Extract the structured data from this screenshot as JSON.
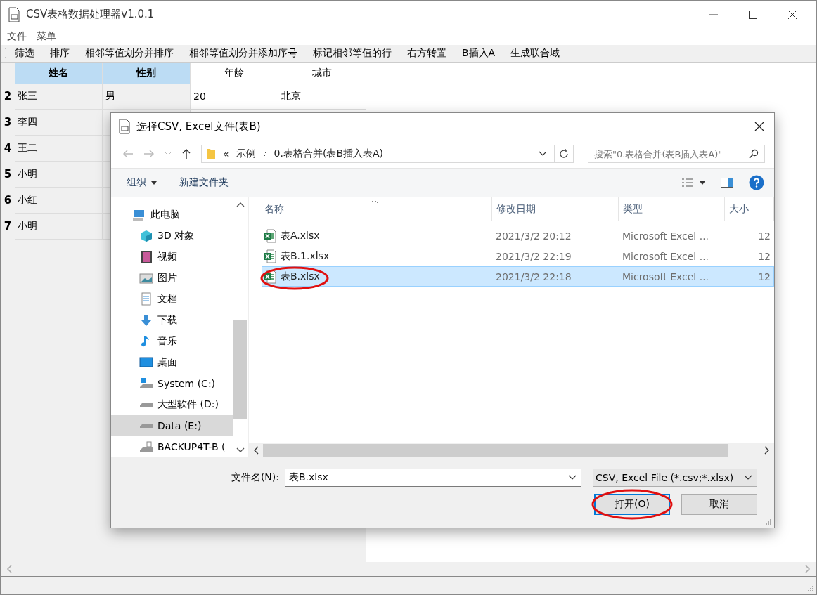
{
  "window": {
    "title": "CSV表格数据处理器v1.0.1"
  },
  "menu": [
    "文件",
    "菜单"
  ],
  "toolbar": [
    "筛选",
    "排序",
    "相邻等值划分并排序",
    "相邻等值划分并添加序号",
    "标记相邻等值的行",
    "右方转置",
    "B插入A",
    "生成联合域"
  ],
  "table": {
    "columns": [
      {
        "label": "姓名",
        "selected": true
      },
      {
        "label": "性别",
        "selected": true
      },
      {
        "label": "年龄",
        "selected": false
      },
      {
        "label": "城市",
        "selected": false
      }
    ],
    "rows": [
      {
        "index": "2",
        "cells": [
          "张三",
          "男",
          "20",
          "北京"
        ]
      },
      {
        "index": "3",
        "cells": [
          "李四"
        ]
      },
      {
        "index": "4",
        "cells": [
          "王二"
        ]
      },
      {
        "index": "5",
        "cells": [
          "小明"
        ]
      },
      {
        "index": "6",
        "cells": [
          "小红"
        ]
      },
      {
        "index": "7",
        "cells": [
          "小明"
        ]
      }
    ]
  },
  "dialog": {
    "title": "选择CSV, Excel文件(表B)",
    "path_overflow": "«",
    "path": [
      "示例",
      "0.表格合并(表B插入表A)"
    ],
    "search": {
      "placeholder": "搜索\"0.表格合并(表B插入表A)\""
    },
    "commands": [
      "组织",
      "新建文件夹"
    ],
    "sidebar": [
      {
        "label": "此电脑",
        "kind": "pc",
        "selected": false,
        "children": [
          {
            "label": "3D 对象",
            "kind": "cube",
            "selected": false
          },
          {
            "label": "视频",
            "kind": "video",
            "selected": false
          },
          {
            "label": "图片",
            "kind": "picture",
            "selected": false
          },
          {
            "label": "文档",
            "kind": "doc",
            "selected": false
          },
          {
            "label": "下载",
            "kind": "download",
            "selected": false
          },
          {
            "label": "音乐",
            "kind": "music",
            "selected": false
          },
          {
            "label": "桌面",
            "kind": "desktop",
            "selected": false
          },
          {
            "label": "System (C:)",
            "kind": "windrive",
            "selected": false
          },
          {
            "label": "大型软件 (D:)",
            "kind": "drive",
            "selected": false
          },
          {
            "label": "Data (E:)",
            "kind": "drive",
            "selected": true
          },
          {
            "label": "BACKUP4T-B (",
            "kind": "usbdrive",
            "selected": false
          }
        ]
      }
    ],
    "file_columns": [
      "名称",
      "修改日期",
      "类型",
      "大小"
    ],
    "files": [
      {
        "name": "表A.xlsx",
        "date": "2021/3/2 20:12",
        "type": "Microsoft Excel ...",
        "size": "12",
        "selected": false,
        "circled": false
      },
      {
        "name": "表B.1.xlsx",
        "date": "2021/3/2 22:19",
        "type": "Microsoft Excel ...",
        "size": "12",
        "selected": false,
        "circled": false
      },
      {
        "name": "表B.xlsx",
        "date": "2021/3/2 22:18",
        "type": "Microsoft Excel ...",
        "size": "12",
        "selected": true,
        "circled": true
      }
    ],
    "filename_label": "文件名(N):",
    "filename": "表B.xlsx",
    "filter": "CSV, Excel File (*.csv;*.xlsx)",
    "buttons": [
      {
        "label": "打开(O)",
        "kind": "primary",
        "circled": true
      },
      {
        "label": "取消",
        "kind": "normal",
        "circled": false
      }
    ]
  }
}
